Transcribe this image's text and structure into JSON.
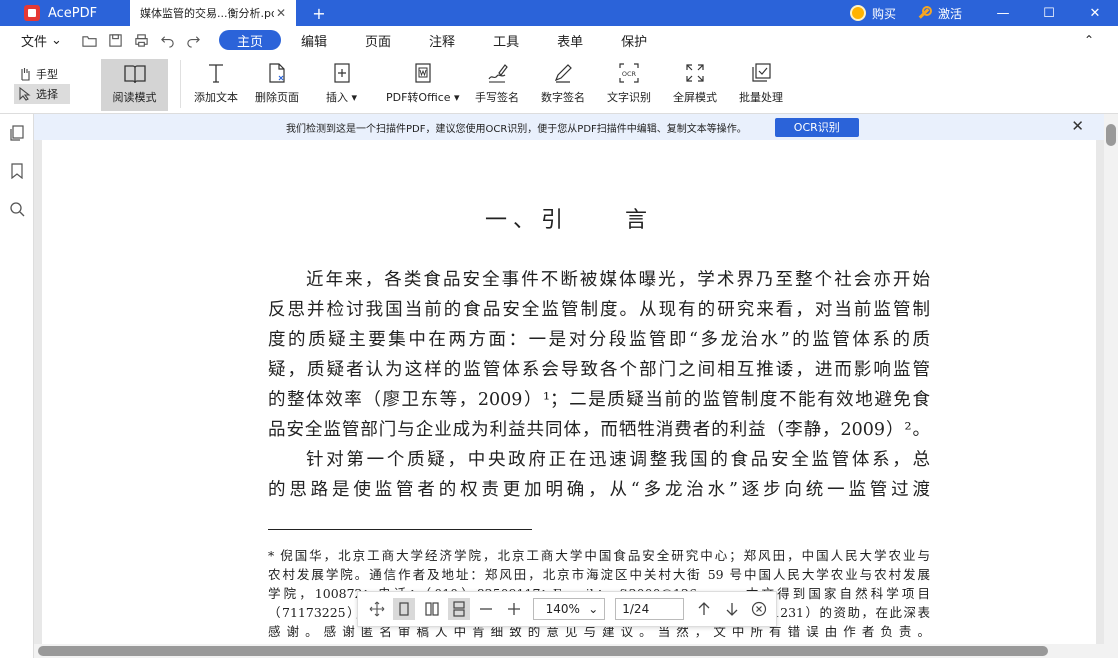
{
  "app": {
    "name": "AcePDF",
    "tab_title": "媒体监管的交易...衡分析.pdf",
    "tab_close": "✕",
    "new_tab": "+",
    "buy_label": "购买",
    "activate_label": "激活",
    "window_controls": [
      "—",
      "☐",
      "✕"
    ]
  },
  "menubar": {
    "file_label": "文件",
    "file_caret": "⌄",
    "tabs": [
      "主页",
      "编辑",
      "页面",
      "注释",
      "工具",
      "表单",
      "保护"
    ],
    "active_tab": "主页",
    "collapse_glyph": "⌃"
  },
  "ribbon": {
    "hand_label": "手型",
    "select_label": "选择",
    "read_mode_label": "阅读模式",
    "tools": [
      {
        "label": "添加文本",
        "icon": "add-text-icon"
      },
      {
        "label": "删除页面",
        "icon": "delete-page-icon"
      },
      {
        "label": "插入",
        "icon": "insert-page-icon",
        "dropdown": true
      },
      {
        "label": "PDF转Office",
        "icon": "pdf-to-office-icon",
        "dropdown": true
      },
      {
        "label": "手写签名",
        "icon": "handwrite-signature-icon"
      },
      {
        "label": "数字签名",
        "icon": "digital-signature-icon"
      },
      {
        "label": "文字识别",
        "icon": "ocr-icon"
      },
      {
        "label": "全屏模式",
        "icon": "fullscreen-icon"
      },
      {
        "label": "批量处理",
        "icon": "batch-process-icon"
      }
    ]
  },
  "ocr_banner": {
    "message": "我们检测到这是一个扫描件PDF，建议您使用OCR识别，便于您从PDF扫描件中编辑、复制文本等操作。",
    "button_label": "OCR识别",
    "close": "✕"
  },
  "document": {
    "heading": "一、引　　言",
    "lines": [
      "近年来，各类食品安全事件不断被媒体曝光，学术界乃至整个社会亦开始",
      "反思并检讨我国当前的食品安全监管制度。从现有的研究来看，对当前监管制",
      "度的质疑主要集中在两方面：一是对分段监管即“多龙治水”的监管体系的质",
      "疑，质疑者认为这样的监管体系会导致各个部门之间相互推诿，进而影响监管",
      "的整体效率（廖卫东等，2009）¹；二是质疑当前的监管制度不能有效地避免食",
      "品安全监管部门与企业成为利益共同体，而牺牲消费者的利益（李静，2009）²。",
      "针对第一个质疑，中央政府正在迅速调整我国的食品安全监管体系，总",
      "的思路是使监管者的权责更加明确，从“多龙治水”逐步向统一监管过渡"
    ],
    "footnotes": [
      "* 倪国华，北京工商大学经济学院，北京工商大学中国食品安全研究中心；郑风田，中国人民大学农业与",
      "农村发展学院。通信作者及地址：郑风田，北京市海淀区中关村大街 59 号中国人民大学农业与农村发展",
      "学院，100872；电话：（010）82509117；E-mail：zft2000@126.com。本文得到国家自然科学项目",
      "（71173225），北京市哲学社会科学规划项目（10AbJG031）和北京工商大学（11231）的资助，在此深表",
      "感谢。感谢匿名审稿人中肯细致的意见与建议。当然，文中所有错误由作者负责。"
    ]
  },
  "page_toolbar": {
    "zoom": "140%",
    "zoom_caret": "⌄",
    "page": "1/24"
  }
}
